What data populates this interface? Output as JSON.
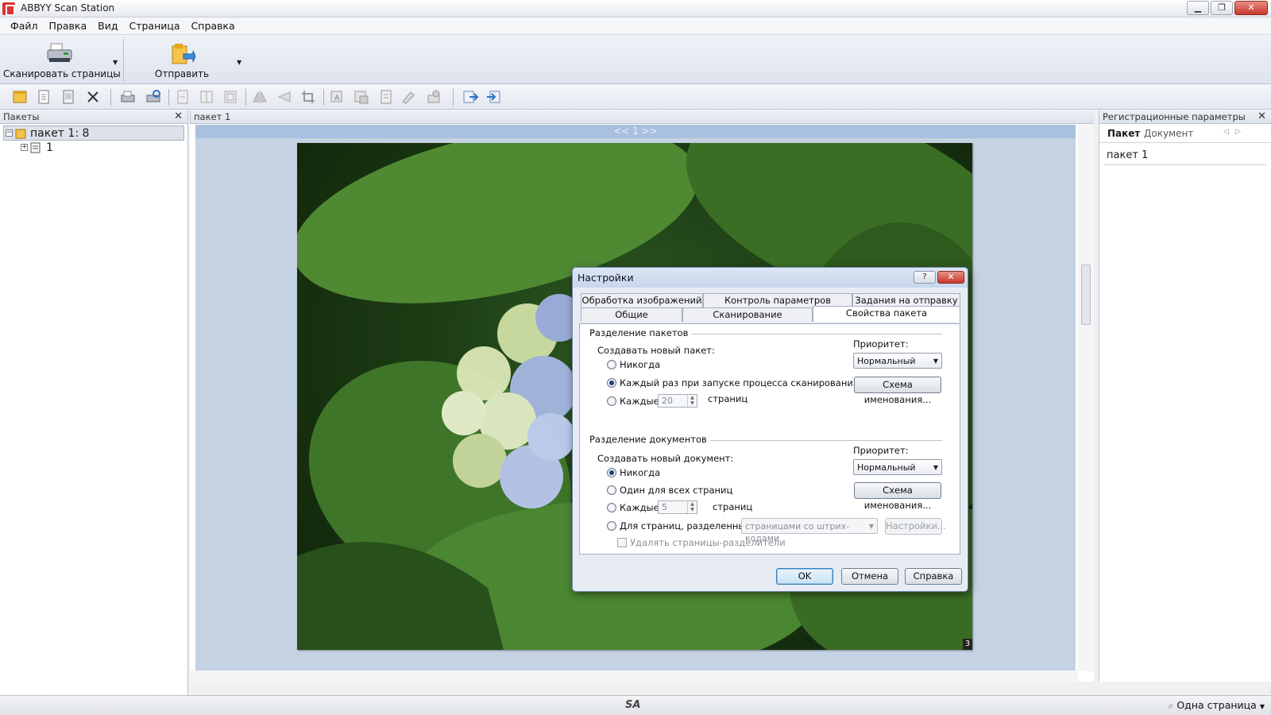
{
  "window": {
    "title": "ABBYY Scan Station",
    "min_label": "▁",
    "max_label": "❐",
    "close_label": "✕"
  },
  "menu": [
    "Файл",
    "Правка",
    "Вид",
    "Страница",
    "Справка"
  ],
  "ribbon": {
    "scan_label": "Сканировать страницы",
    "send_label": "Отправить"
  },
  "left_panel": {
    "title": "Пакеты",
    "close_label": "✕",
    "tree": [
      {
        "label": "пакет 1: 8",
        "expander": "−"
      },
      {
        "label": "1",
        "expander": "+"
      }
    ]
  },
  "center_panel": {
    "title": "пакет 1",
    "page_nav": "<< 1 >>",
    "page_number": "3"
  },
  "right_panel": {
    "title": "Регистрационные параметры",
    "close_label": "✕",
    "tabs": [
      "Пакет",
      "Документ"
    ],
    "field_value": "пакет 1"
  },
  "status_bar": {
    "center": "SA",
    "mode": "Одна страница"
  },
  "dialog": {
    "title": "Настройки",
    "help_label": "?",
    "close_label": "✕",
    "tabs_row1": [
      "Обработка изображений",
      "Контроль параметров страниц",
      "Задания на отправку"
    ],
    "tabs_row2": [
      "Общие",
      "Сканирование",
      "Свойства пакета"
    ],
    "batch_split": {
      "group_title": "Разделение пакетов",
      "create_label": "Создавать новый пакет:",
      "priority_label": "Приоритет:",
      "priority_value": "Нормальный",
      "naming_button": "Схема именования...",
      "options": [
        "Никогда",
        "Каждый раз при запуске процесса сканирования",
        "Каждые"
      ],
      "pages_value": "20",
      "pages_suffix": "страниц"
    },
    "doc_split": {
      "group_title": "Разделение документов",
      "create_label": "Создавать новый документ:",
      "priority_label": "Приоритет:",
      "priority_value": "Нормальный",
      "naming_button": "Схема именования...",
      "options": [
        "Никогда",
        "Один для всех страниц",
        "Каждые",
        "Для страниц, разделенных:"
      ],
      "pages_value": "5",
      "pages_suffix": "страниц",
      "separator_combo": "страницами со штрих-кодами",
      "settings_button": "Настройки...",
      "delete_separators": "Удалять страницы-разделители"
    },
    "buttons": {
      "ok": "OK",
      "cancel": "Отмена",
      "help": "Справка"
    }
  }
}
